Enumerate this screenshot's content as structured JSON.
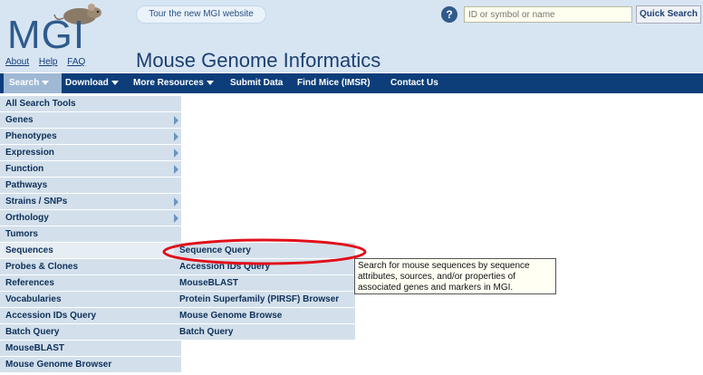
{
  "header": {
    "logo": "MGI",
    "links": [
      "About",
      "Help",
      "FAQ"
    ],
    "tour_label": "Tour the new MGI website",
    "title": "Mouse Genome Informatics",
    "help_icon": "?",
    "search_placeholder": "ID or symbol or name",
    "quick_search_label": "Quick Search"
  },
  "nav": {
    "items": [
      "Search",
      "Download",
      "More Resources",
      "Submit Data",
      "Find Mice (IMSR)",
      "Contact Us"
    ]
  },
  "menu": {
    "items": [
      "All Search Tools",
      "Genes",
      "Phenotypes",
      "Expression",
      "Function",
      "Pathways",
      "Strains / SNPs",
      "Orthology",
      "Tumors",
      "Sequences",
      "Probes & Clones",
      "References",
      "Vocabularies",
      "Accession IDs Query",
      "Batch Query",
      "MouseBLAST",
      "Mouse Genome Browser"
    ]
  },
  "submenu": {
    "items": [
      "Sequence Query",
      "Accession IDs Query",
      "MouseBLAST",
      "Protein Superfamily (PIRSF) Browser",
      "Mouse Genome Browse",
      "Batch Query"
    ]
  },
  "tooltip": {
    "text": "Search for mouse sequences by sequence attributes, sources, and/or properties of associated genes and markers in MGI."
  },
  "colors": {
    "header_bg": "#d7e5f2",
    "nav_bg": "#0d3e7a",
    "menu_bg": "#d3e0eb",
    "annotation": "#e0101a"
  }
}
